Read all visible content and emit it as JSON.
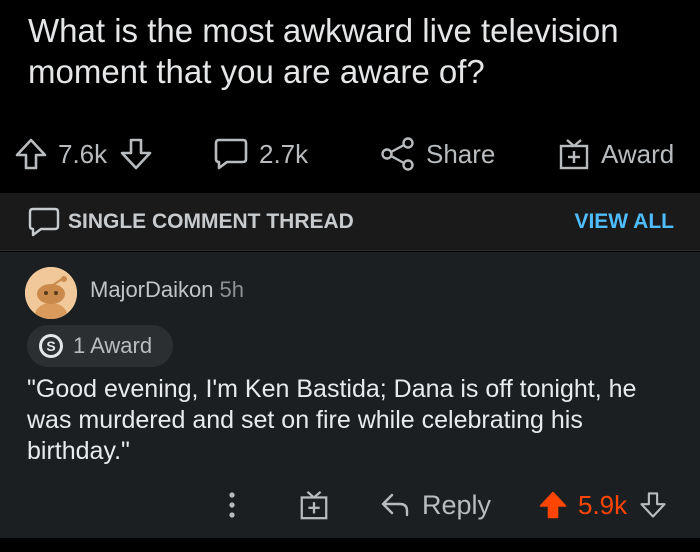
{
  "post": {
    "title": "What is the most awkward live television moment that you are aware of?",
    "upvotes": "7.6k",
    "comments": "2.7k",
    "share_label": "Share",
    "award_label": "Award"
  },
  "thread_bar": {
    "label": "SINGLE COMMENT THREAD",
    "view_all_label": "VIEW ALL"
  },
  "comment": {
    "username": "MajorDaikon",
    "time": "5h",
    "award_count": "1 Award",
    "award_coin_letter": "S",
    "body": "\"Good evening, I'm Ken Bastida; Dana is off tonight, he was murdered and set on fire while celebrating his birthday.\"",
    "reply_label": "Reply",
    "score": "5.9k"
  },
  "colors": {
    "background": "#000000",
    "comment_bg": "#1c1f21",
    "thread_bar_bg": "#1a1a1b",
    "link_blue": "#4fbcff",
    "upvote_orange": "#ff4500",
    "text": "#e4e6e8",
    "muted": "#b9bcbf"
  },
  "icons": [
    "upvote-arrow-icon",
    "downvote-arrow-icon",
    "comment-bubble-icon",
    "share-icon",
    "gift-icon",
    "more-dots-icon",
    "reply-arrow-icon",
    "award-coin-icon",
    "snoo-avatar"
  ]
}
